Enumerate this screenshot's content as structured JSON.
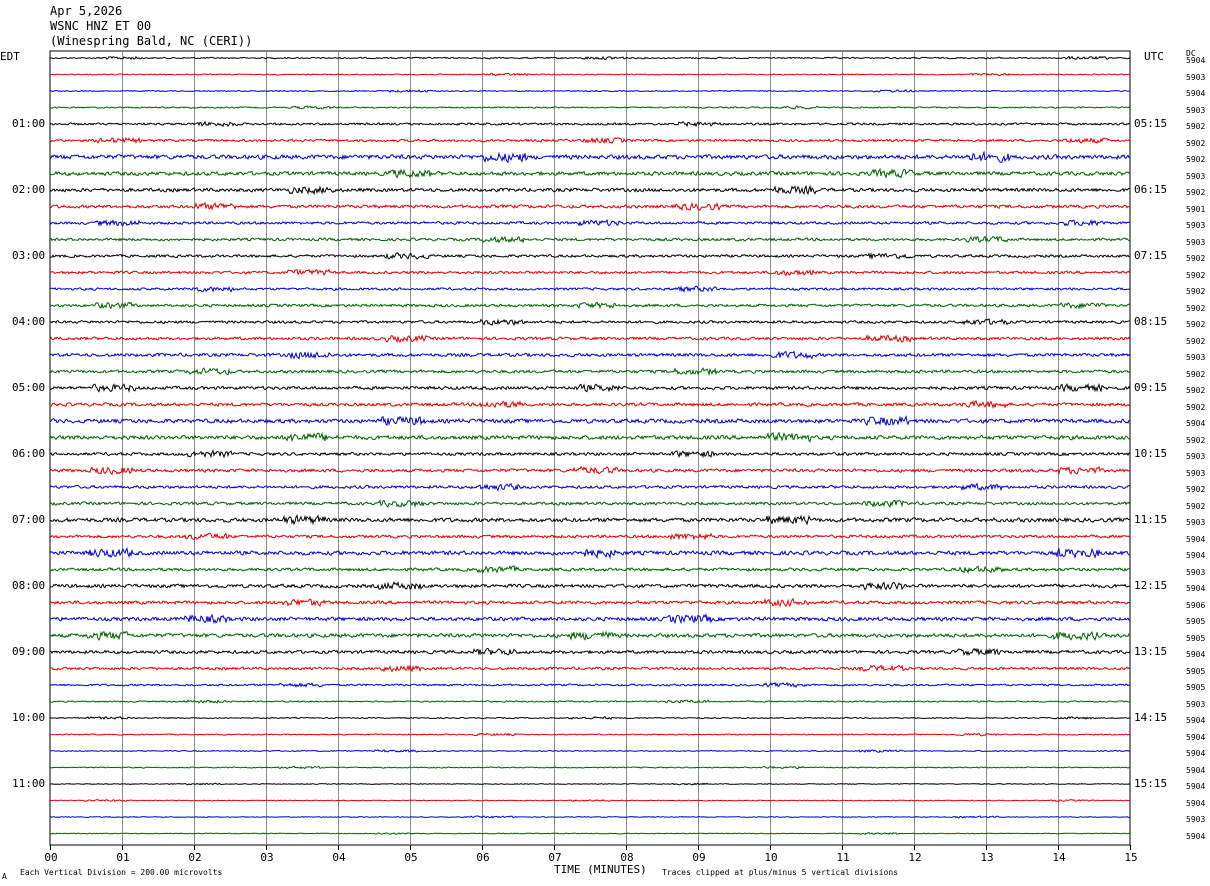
{
  "header": {
    "date": "Apr 5,2026",
    "station": "WSNC HNZ ET 00",
    "location": "(Winespring Bald, NC (CERI))"
  },
  "left_label": "EDT",
  "right_label": "UTC",
  "dc_label": "DC",
  "footer": {
    "left": "Each Vertical Division =  200.00 microvolts",
    "corner_mark": "A",
    "xlabel": "TIME (MINUTES)",
    "clip_note": "Traces clipped at plus/minus 5 vertical divisions"
  },
  "chart_data": {
    "type": "line",
    "title": "WSNC HNZ ET 00",
    "xlabel": "TIME (MINUTES)",
    "xlim": [
      0,
      15
    ],
    "x_ticks": [
      "00",
      "01",
      "02",
      "03",
      "04",
      "05",
      "06",
      "07",
      "08",
      "09",
      "10",
      "11",
      "12",
      "13",
      "14",
      "15"
    ],
    "trace_colors": [
      "#000000",
      "#e00000",
      "#0000d0",
      "#006000"
    ],
    "traces_per_hour": 4,
    "edt_hour_labels": [
      "01:00",
      "02:00",
      "03:00",
      "04:00",
      "05:00",
      "06:00",
      "07:00",
      "08:00",
      "09:00",
      "10:00",
      "11:00"
    ],
    "utc_hour_labels": [
      "05:15",
      "06:15",
      "07:15",
      "08:15",
      "09:15",
      "10:15",
      "11:15",
      "12:15",
      "13:15",
      "14:15",
      "15:15"
    ],
    "trace_dc_offsets": [
      "5904",
      "5903",
      "5904",
      "5903",
      "5902",
      "5902",
      "5902",
      "5903",
      "5902",
      "5901",
      "5903",
      "5903",
      "5902",
      "5902",
      "5902",
      "5902",
      "5902",
      "5902",
      "5903",
      "5902",
      "5902",
      "5902",
      "5904",
      "5902",
      "5903",
      "5903",
      "5902",
      "5902",
      "5903",
      "5904",
      "5904",
      "5903",
      "5904",
      "5906",
      "5905",
      "5905",
      "5904",
      "5905",
      "5905",
      "5903",
      "5904",
      "5904",
      "5904",
      "5904",
      "5904",
      "5904",
      "5903",
      "5904"
    ],
    "activity_levels": [
      0.25,
      0.2,
      0.2,
      0.25,
      0.4,
      0.45,
      0.8,
      0.7,
      0.65,
      0.6,
      0.5,
      0.5,
      0.5,
      0.5,
      0.45,
      0.5,
      0.5,
      0.55,
      0.6,
      0.55,
      0.6,
      0.6,
      0.75,
      0.75,
      0.55,
      0.6,
      0.55,
      0.55,
      0.75,
      0.55,
      0.75,
      0.55,
      0.65,
      0.6,
      0.7,
      0.7,
      0.6,
      0.5,
      0.35,
      0.25,
      0.2,
      0.2,
      0.2,
      0.2,
      0.15,
      0.15,
      0.15,
      0.15
    ]
  }
}
